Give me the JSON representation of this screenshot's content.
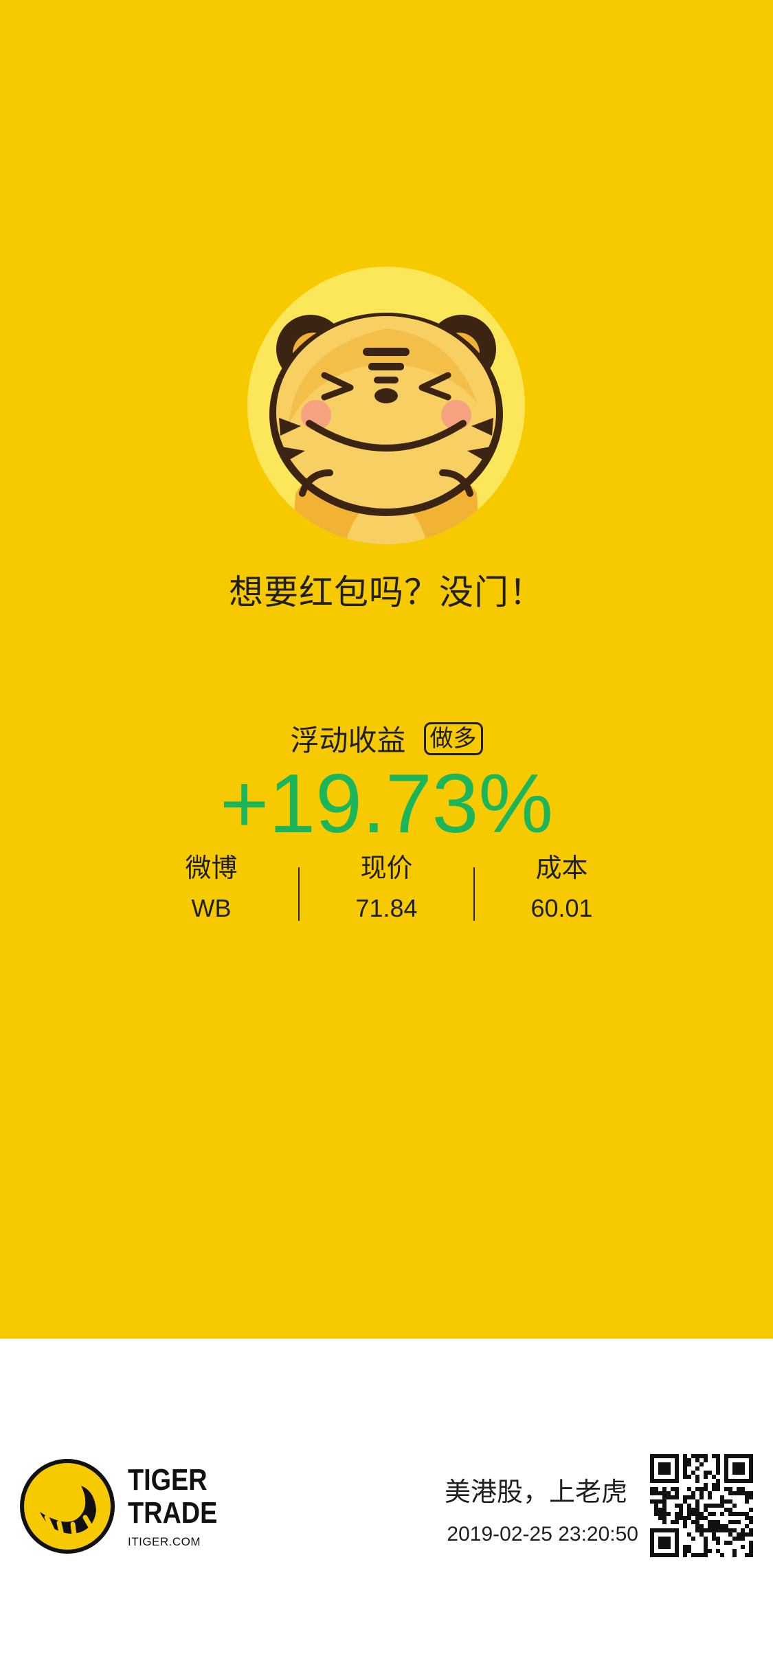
{
  "poster": {
    "tagline": "想要红包吗？没门！",
    "profit_label": "浮动收益",
    "position_badge": "做多",
    "profit_value": "+19.73%",
    "stats": [
      {
        "label": "微博",
        "value": "WB"
      },
      {
        "label": "现价",
        "value": "71.84"
      },
      {
        "label": "成本",
        "value": "60.01"
      }
    ],
    "mascot": "smiling-tiger-mascot"
  },
  "footer": {
    "brand_line1": "TIGER",
    "brand_line2": "TRADE",
    "brand_site": "ITIGER.COM",
    "slogan": "美港股，上老虎",
    "timestamp": "2019-02-25 23:20:50",
    "logo_icon": "tiger-trade-logo-icon",
    "qr_icon": "qr-code-icon"
  },
  "colors": {
    "background_yellow": "#F7CA00",
    "profit_green": "#1BB55C",
    "footer_background": "#FFFFFF",
    "text": "#1F1F1F"
  }
}
